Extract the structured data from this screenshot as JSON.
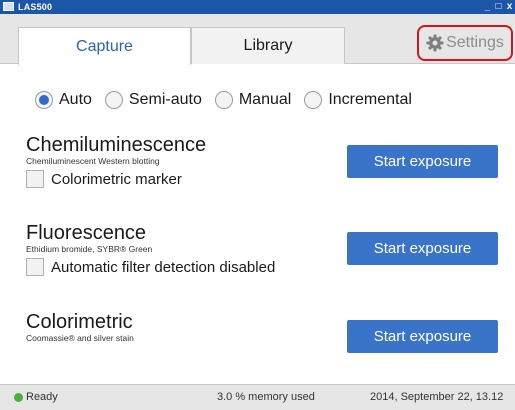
{
  "window": {
    "title": "LAS500",
    "controls": [
      "_",
      "□",
      "x"
    ]
  },
  "tabs": {
    "capture": "Capture",
    "library": "Library"
  },
  "settings": {
    "label": "Settings",
    "icon": "gear-icon"
  },
  "modes": [
    {
      "label": "Auto",
      "checked": true
    },
    {
      "label": "Semi-auto",
      "checked": false
    },
    {
      "label": "Manual",
      "checked": false
    },
    {
      "label": "Incremental",
      "checked": false
    }
  ],
  "sections": {
    "chemi": {
      "title": "Chemiluminescence",
      "subtitle": "Chemiluminescent Western blotting",
      "checkbox": "Colorimetric marker",
      "button": "Start exposure"
    },
    "fluor": {
      "title": "Fluorescence",
      "subtitle": "Ethidium bromide, SYBR® Green",
      "checkbox": "Automatic filter detection disabled",
      "button": "Start exposure"
    },
    "color": {
      "title": "Colorimetric",
      "subtitle": "Coomassie® and silver stain",
      "button": "Start exposure"
    }
  },
  "status": {
    "state": "Ready",
    "memory": "3.0 % memory used",
    "datetime": "2014, September 22, 13.12"
  },
  "colors": {
    "accent": "#3a74c8",
    "titlebar": "#1c56a8",
    "highlight": "#d6141c",
    "status_ok": "#4caf3c"
  }
}
